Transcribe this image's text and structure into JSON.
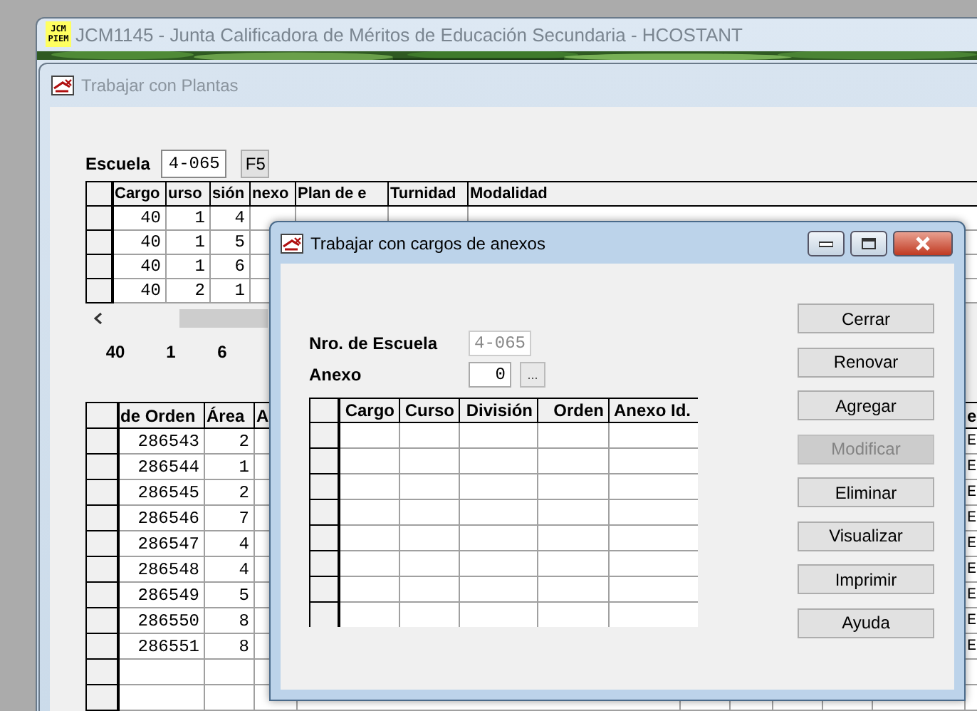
{
  "main_window": {
    "icon_text": [
      "JCM",
      "PIEM"
    ],
    "title": "JCM1145 - Junta Calificadora de Méritos de Educación Secundaria - HCOSTANT"
  },
  "plantas_window": {
    "title": "Trabajar con Plantas",
    "escuela_label": "Escuela",
    "escuela_value": "4-065",
    "f5_button": "F5",
    "cargos_grid": {
      "columns": [
        "Cargo",
        "urso",
        "sión",
        "nexo",
        "Plan de e",
        "Turnidad",
        "Modalidad"
      ],
      "rows": [
        [
          "40",
          "1",
          "4",
          ""
        ],
        [
          "40",
          "1",
          "5",
          ""
        ],
        [
          "40",
          "1",
          "6",
          ""
        ],
        [
          "40",
          "2",
          "1",
          ""
        ]
      ]
    },
    "summary": [
      "40",
      "1",
      "6"
    ],
    "ordenes_grid": {
      "columns": [
        "de Orden",
        "Área",
        "A",
        "e"
      ],
      "rows": [
        [
          "286543",
          "2",
          "",
          "E"
        ],
        [
          "286544",
          "1",
          "",
          "E"
        ],
        [
          "286545",
          "2",
          "",
          "E"
        ],
        [
          "286546",
          "7",
          "",
          "E"
        ],
        [
          "286547",
          "4",
          "",
          "E"
        ],
        [
          "286548",
          "4",
          "",
          "E"
        ],
        [
          "286549",
          "5",
          "",
          "E"
        ],
        [
          "286550",
          "8",
          "",
          "E"
        ],
        [
          "286551",
          "8",
          "",
          "E"
        ]
      ]
    }
  },
  "dialog": {
    "title": "Trabajar con cargos de anexos",
    "escuela_label": "Nro. de Escuela",
    "escuela_value": "4-065",
    "anexo_label": "Anexo",
    "anexo_value": "0",
    "browse_button": "...",
    "grid": {
      "columns": [
        "Cargo",
        "Curso",
        "División",
        "Orden",
        "Anexo Id."
      ]
    },
    "buttons": [
      {
        "label": "Cerrar",
        "disabled": false
      },
      {
        "label": "Renovar",
        "disabled": false
      },
      {
        "label": "Agregar",
        "disabled": false
      },
      {
        "label": "Modificar",
        "disabled": true
      },
      {
        "label": "Eliminar",
        "disabled": false
      },
      {
        "label": "Visualizar",
        "disabled": false
      },
      {
        "label": "Imprimir",
        "disabled": false
      },
      {
        "label": "Ayuda",
        "disabled": false
      }
    ]
  }
}
